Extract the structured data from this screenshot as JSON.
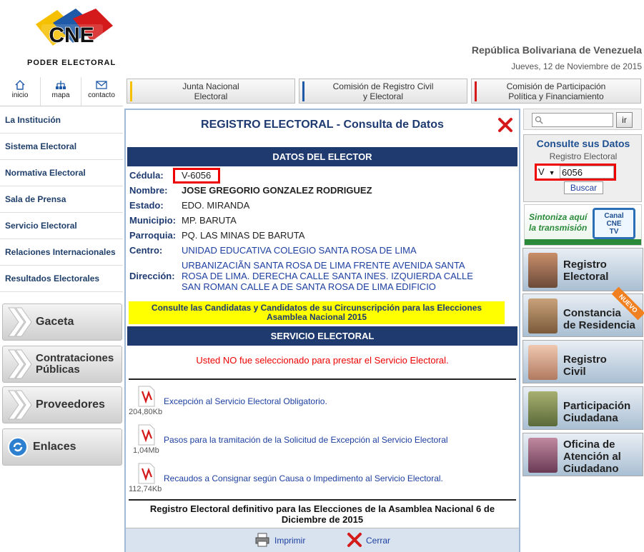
{
  "header": {
    "logo_text": "CNE",
    "logo_sub": "PODER ELECTORAL",
    "republic": "República Bolivariana de Venezuela",
    "date": "Jueves, 12 de Noviembre de 2015"
  },
  "top_icons": [
    {
      "label": "inicio",
      "icon": "home-icon"
    },
    {
      "label": "mapa",
      "icon": "sitemap-icon"
    },
    {
      "label": "contacto",
      "icon": "mail-icon"
    }
  ],
  "top_buttons": [
    {
      "line1": "Junta Nacional",
      "line2": "Electoral",
      "color": "#f5c000"
    },
    {
      "line1": "Comisión de Registro Civil",
      "line2": "y Electoral",
      "color": "#1e5aa8"
    },
    {
      "line1": "Comisión de Participación",
      "line2": "Política y Financiamiento",
      "color": "#d41a1a"
    }
  ],
  "sidebar": {
    "items": [
      "La Institución",
      "Sistema Electoral",
      "Normativa Electoral",
      "Sala de Prensa",
      "Servicio Electoral",
      "Relaciones Internacionales",
      "Resultados Electorales"
    ],
    "big_buttons": [
      {
        "line1": "Gaceta",
        "line2": ""
      },
      {
        "line1": "Contrataciones",
        "line2": "Públicas"
      },
      {
        "line1": "Proveedores",
        "line2": ""
      },
      {
        "line1": "Enlaces",
        "line2": ""
      }
    ]
  },
  "dialog": {
    "title": "REGISTRO ELECTORAL - Consulta de Datos",
    "elector_header": "DATOS DEL ELECTOR",
    "fields": {
      "cedula_label": "Cédula:",
      "cedula": "V-6056",
      "nombre_label": "Nombre:",
      "nombre": "JOSE GREGORIO GONZALEZ RODRIGUEZ",
      "estado_label": "Estado:",
      "estado": "EDO. MIRANDA",
      "municipio_label": "Municipio:",
      "municipio": "MP. BARUTA",
      "parroquia_label": "Parroquia:",
      "parroquia": "PQ. LAS MINAS DE BARUTA",
      "centro_label": "Centro:",
      "centro": "UNIDAD EDUCATIVA COLEGIO SANTA ROSA DE LIMA",
      "direccion_label": "Dirección:",
      "direccion_l1": "URBANIZACIÃN SANTA ROSA DE LIMA FRENTE AVENIDA SANTA",
      "direccion_l2": "ROSA DE LIMA. DERECHA CALLE SANTA INES. IZQUIERDA CALLE",
      "direccion_l3": "SAN ROMAN CALLE A DE SANTA ROSA DE LIMA EDIFICIO"
    },
    "yellow_l1": "Consulte las Candidatas y Candidatos de su Circunscripción para las Elecciones",
    "yellow_l2": "Asamblea Nacional 2015",
    "servicio_header": "SERVICIO ELECTORAL",
    "not_selected": "Usted NO fue seleccionado para prestar el Servicio Electoral.",
    "documents": [
      {
        "title": "Excepción al Servicio Electoral Obligatorio.",
        "size": "204,80Kb"
      },
      {
        "title": "Pasos para la tramitación de la Solicitud de Excepción al Servicio Electoral",
        "size": "1,04Mb"
      },
      {
        "title": "Recaudos a Consignar según Causa o Impedimento al Servicio Electoral.",
        "size": "112,74Kb"
      }
    ],
    "final_l1": "Registro Electoral definitivo para las Elecciones de la Asamblea Nacional 6 de",
    "final_l2": "Diciembre de 2015",
    "print_label": "Imprimir",
    "close_label": "Cerrar"
  },
  "right": {
    "search_button": "ir",
    "consult_title": "Consulte sus Datos",
    "consult_sub": "Registro Electoral",
    "nationality": "V",
    "cedula_value": "6056",
    "buscar": "Buscar",
    "tv_l1": "Sintoniza aquí",
    "tv_l2": "la transmisión",
    "tv_logo_l1": "Canal",
    "tv_logo_l2": "CNE",
    "tv_logo_l3": "TV",
    "buttons": [
      {
        "line1": "Registro",
        "line2": "Electoral",
        "line3": ""
      },
      {
        "line1": "Constancia",
        "line2": "de Residencia",
        "line3": "",
        "badge": "NUEVO"
      },
      {
        "line1": "Registro",
        "line2": "Civil",
        "line3": ""
      },
      {
        "line1": "Participación",
        "line2": "Ciudadana",
        "line3": ""
      },
      {
        "line1": "Oficina de",
        "line2": "Atención al",
        "line3": "Ciudadano"
      }
    ]
  },
  "colors": {
    "accent": "#1f3a6e",
    "highlight": "#e00000",
    "link": "#1d3fa0"
  }
}
